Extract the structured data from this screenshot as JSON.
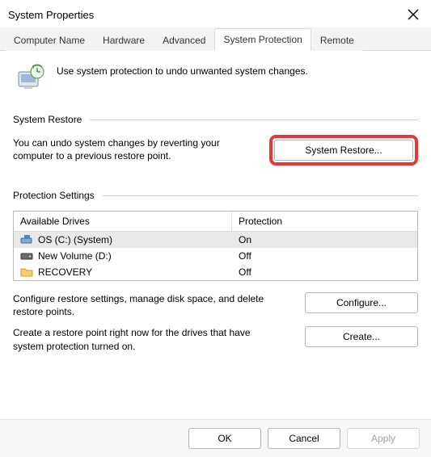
{
  "window": {
    "title": "System Properties"
  },
  "tabs": [
    {
      "label": "Computer Name",
      "selected": false
    },
    {
      "label": "Hardware",
      "selected": false
    },
    {
      "label": "Advanced",
      "selected": false
    },
    {
      "label": "System Protection",
      "selected": true
    },
    {
      "label": "Remote",
      "selected": false
    }
  ],
  "intro": {
    "text": "Use system protection to undo unwanted system changes."
  },
  "restore": {
    "header": "System Restore",
    "desc": "You can undo system changes by reverting your computer to a previous restore point.",
    "button": "System Restore..."
  },
  "protection": {
    "header": "Protection Settings",
    "columns": {
      "drives": "Available Drives",
      "protection": "Protection"
    },
    "rows": [
      {
        "icon": "disk-system",
        "name": "OS (C:) (System)",
        "protection": "On",
        "selected": true
      },
      {
        "icon": "disk",
        "name": "New Volume (D:)",
        "protection": "Off",
        "selected": false
      },
      {
        "icon": "folder",
        "name": "RECOVERY",
        "protection": "Off",
        "selected": false
      }
    ],
    "configure": {
      "desc": "Configure restore settings, manage disk space, and delete restore points.",
      "button": "Configure..."
    },
    "create": {
      "desc": "Create a restore point right now for the drives that have system protection turned on.",
      "button": "Create..."
    }
  },
  "footer": {
    "ok": "OK",
    "cancel": "Cancel",
    "apply": "Apply"
  }
}
